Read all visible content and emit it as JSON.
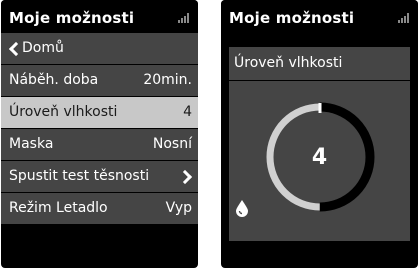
{
  "left_screen": {
    "title": "Moje možnosti",
    "menu": {
      "back_label": "Domů",
      "items": [
        {
          "label": "Náběh. doba",
          "value": "20min."
        },
        {
          "label": "Úroveň vlhkosti",
          "value": "4"
        },
        {
          "label": "Maska",
          "value": "Nosní"
        },
        {
          "label": "Spustit test těsnosti"
        },
        {
          "label": "Režim Letadlo",
          "value": "Vyp"
        }
      ]
    }
  },
  "right_screen": {
    "title": "Moje možnosti",
    "panel_title": "Úroveň vlhkosti",
    "level": {
      "value": "4",
      "max": 8
    }
  },
  "icons": {
    "signal": "signal-bars-icon",
    "back": "chevron-left-icon",
    "forward": "chevron-right-icon",
    "humidity": "water-drop-icon"
  },
  "colors": {
    "screen_bg": "#000000",
    "item_bg": "#454545",
    "selected_bg": "#c8c8c8",
    "text": "#ffffff",
    "gauge_track": "#d0d0d0",
    "gauge_fill": "#000000"
  }
}
